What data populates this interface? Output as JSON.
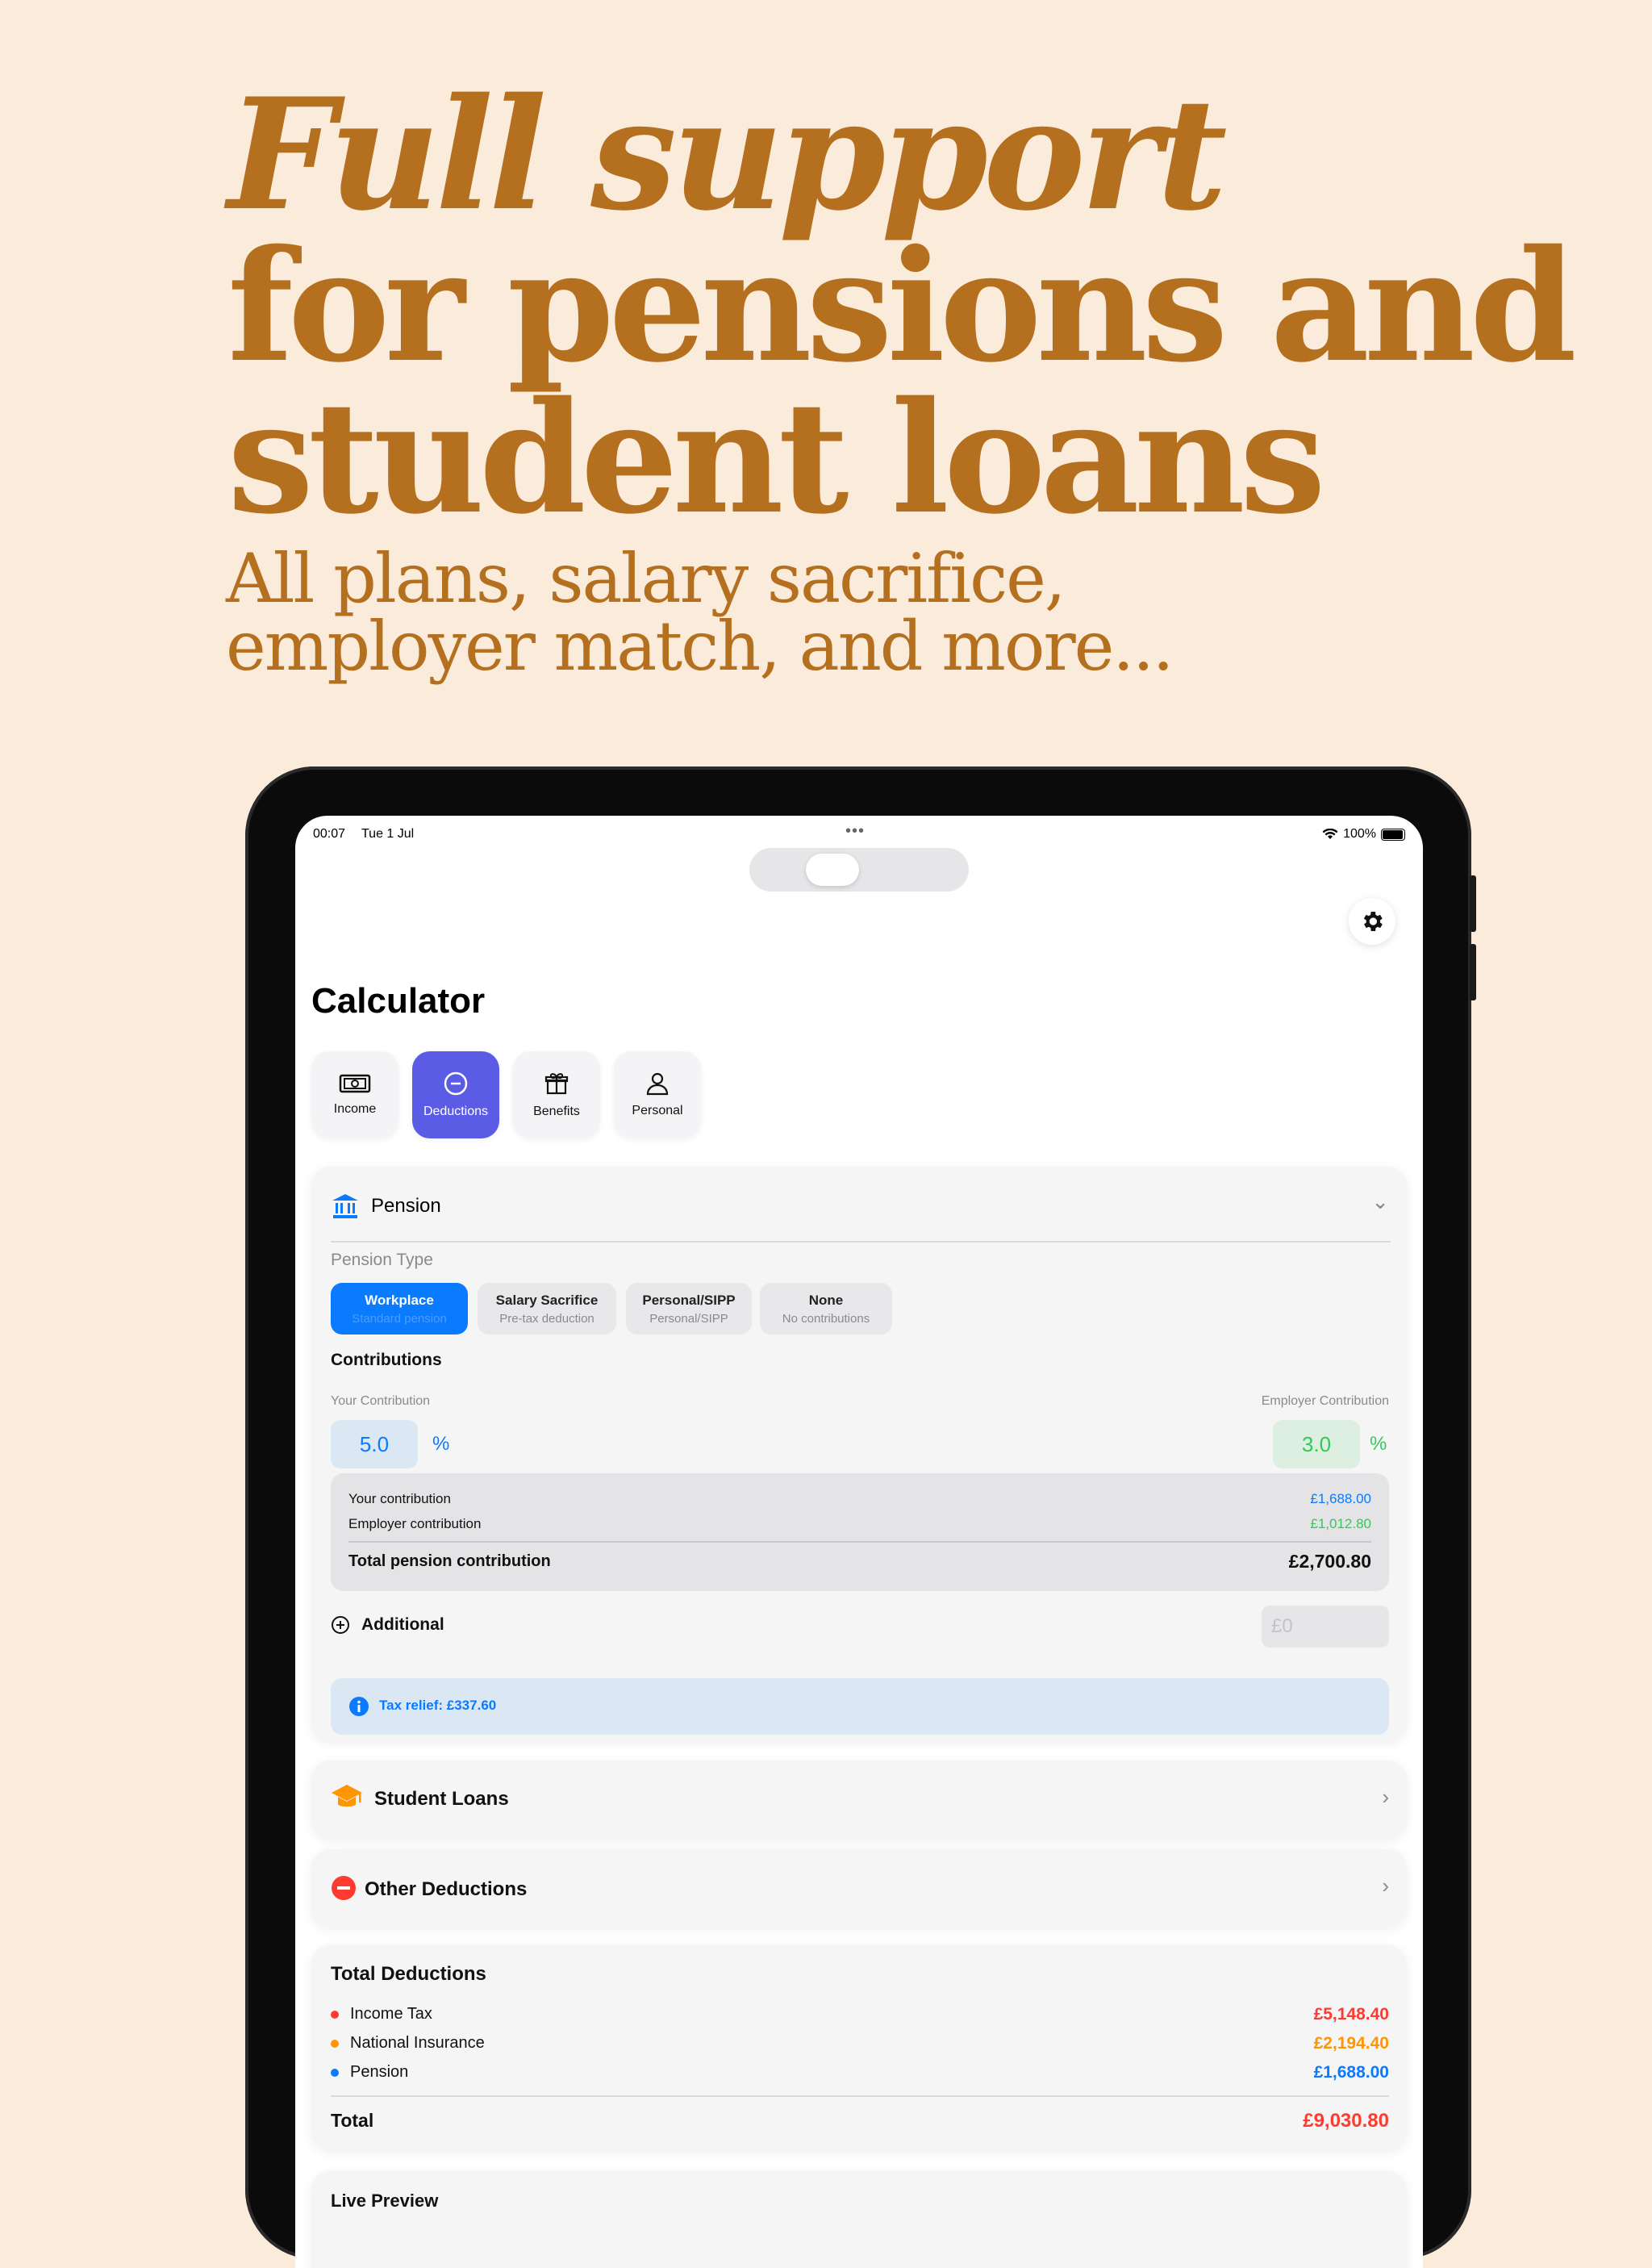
{
  "hero": {
    "line1": "Full support",
    "line2": "for pensions and",
    "line3": "student loans",
    "sub1": "All plans, salary sacrifice,",
    "sub2": "employer match, and more..."
  },
  "status_bar": {
    "time": "00:07",
    "date": "Tue 1 Jul",
    "battery": "100%"
  },
  "page": {
    "title": "Calculator"
  },
  "tabs": [
    {
      "label": "Income",
      "icon": "banknote-icon"
    },
    {
      "label": "Deductions",
      "icon": "minus-circle-icon",
      "active": true
    },
    {
      "label": "Benefits",
      "icon": "gift-icon"
    },
    {
      "label": "Personal",
      "icon": "person-icon"
    }
  ],
  "pension": {
    "title": "Pension",
    "type_label": "Pension Type",
    "types": [
      {
        "title": "Workplace",
        "subtitle": "Standard pension",
        "active": true
      },
      {
        "title": "Salary Sacrifice",
        "subtitle": "Pre-tax deduction"
      },
      {
        "title": "Personal/SIPP",
        "subtitle": "Personal/SIPP"
      },
      {
        "title": "None",
        "subtitle": "No contributions"
      }
    ],
    "contributions_label": "Contributions",
    "your_label": "Your Contribution",
    "your_value": "5.0",
    "employer_label": "Employer Contribution",
    "employer_value": "3.0",
    "percent": "%",
    "summary": {
      "your_label": "Your contribution",
      "your_value": "£1,688.00",
      "employer_label": "Employer contribution",
      "employer_value": "£1,012.80",
      "total_label": "Total pension contribution",
      "total_value": "£2,700.80"
    },
    "additional_label": "Additional",
    "additional_placeholder": "£0",
    "tax_relief": "Tax relief: £337.60"
  },
  "student_loans": {
    "title": "Student Loans"
  },
  "other_deductions": {
    "title": "Other Deductions"
  },
  "total_deductions": {
    "title": "Total Deductions",
    "items": [
      {
        "label": "Income Tax",
        "value": "£5,148.40",
        "color": "#FF3B30"
      },
      {
        "label": "National Insurance",
        "value": "£2,194.40",
        "color": "#FF9500"
      },
      {
        "label": "Pension",
        "value": "£1,688.00",
        "color": "#0A7AFF"
      }
    ],
    "total_label": "Total",
    "total_value": "£9,030.80"
  },
  "live_preview": {
    "title": "Live Preview"
  },
  "colors": {
    "accent": "#5B5CE6",
    "blue": "#0A7AFF",
    "green": "#34C759",
    "red": "#FF3B30",
    "orange": "#FF9500",
    "hero": "#B5701F"
  }
}
